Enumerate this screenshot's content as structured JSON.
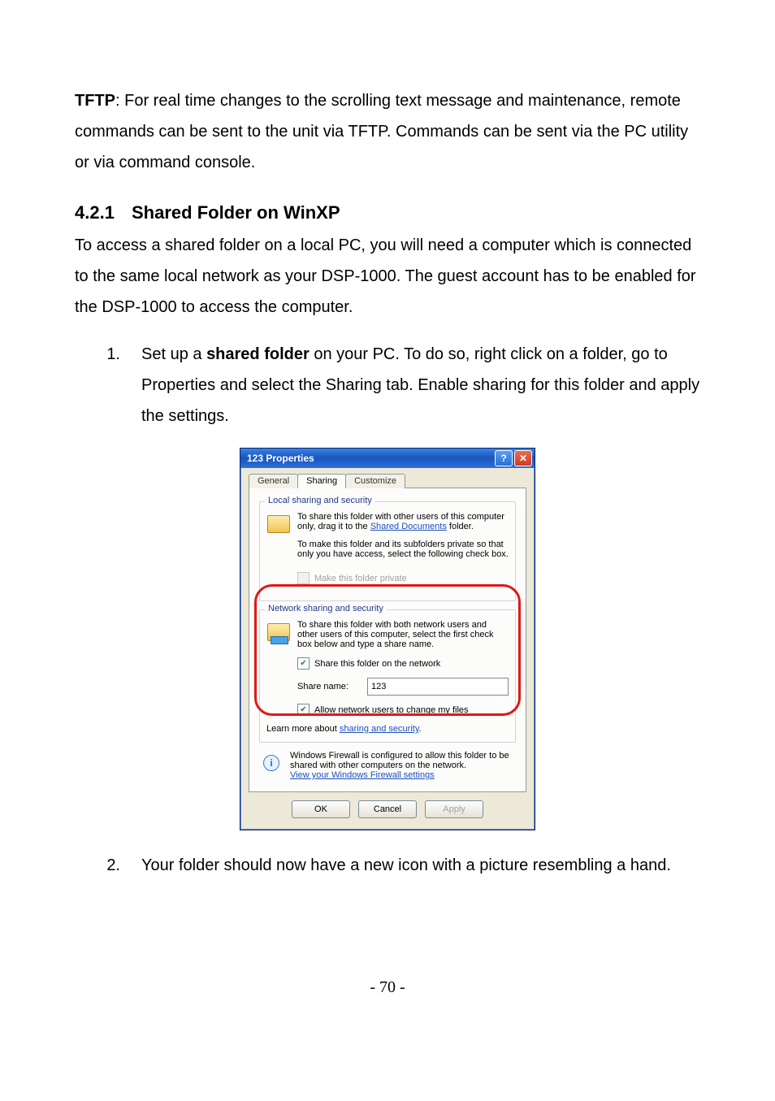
{
  "tftp": {
    "label": "TFTP",
    "text": ": For real time changes to the scrolling text message and maintenance, remote commands can be sent to the unit via TFTP. Commands can be sent via the PC utility or via command console."
  },
  "section": {
    "number": "4.2.1",
    "title": "Shared Folder on WinXP",
    "intro": "To access a shared folder on a local PC, you will need a computer which is connected to the same local network as your DSP-1000. The guest account has to be enabled for the DSP-1000 to access the computer."
  },
  "steps": {
    "s1_num": "1.",
    "s1_a": "Set up a ",
    "s1_bold": "shared folder",
    "s1_b": " on your PC. To do so, right click on a folder, go to Properties and select the Sharing tab. Enable sharing for this folder and apply the settings.",
    "s2_num": "2.",
    "s2": "Your folder should now have a new icon with a picture resembling a hand."
  },
  "dialog": {
    "title": "123 Properties",
    "tabs": {
      "general": "General",
      "sharing": "Sharing",
      "customize": "Customize"
    },
    "group_local": {
      "legend": "Local sharing and security",
      "p1a": "To share this folder with other users of this computer only, drag it to the ",
      "p1_link": "Shared Documents",
      "p1b": " folder.",
      "p2": "To make this folder and its subfolders private so that only you have access, select the following check box.",
      "chk": "Make this folder private"
    },
    "group_net": {
      "legend": "Network sharing and security",
      "p1": "To share this folder with both network users and other users of this computer, select the first check box below and type a share name.",
      "chk_share": "Share this folder on the network",
      "share_label": "Share name:",
      "share_value": "123",
      "chk_allow": "Allow network users to change my files",
      "learn_a": "Learn more about ",
      "learn_link": "sharing and security",
      "learn_b": "."
    },
    "firewall": {
      "p1": "Windows Firewall is configured to allow this folder to be shared with other computers on the network.",
      "link": "View your Windows Firewall settings"
    },
    "buttons": {
      "ok": "OK",
      "cancel": "Cancel",
      "apply": "Apply"
    }
  },
  "page_number": "- 70 -"
}
